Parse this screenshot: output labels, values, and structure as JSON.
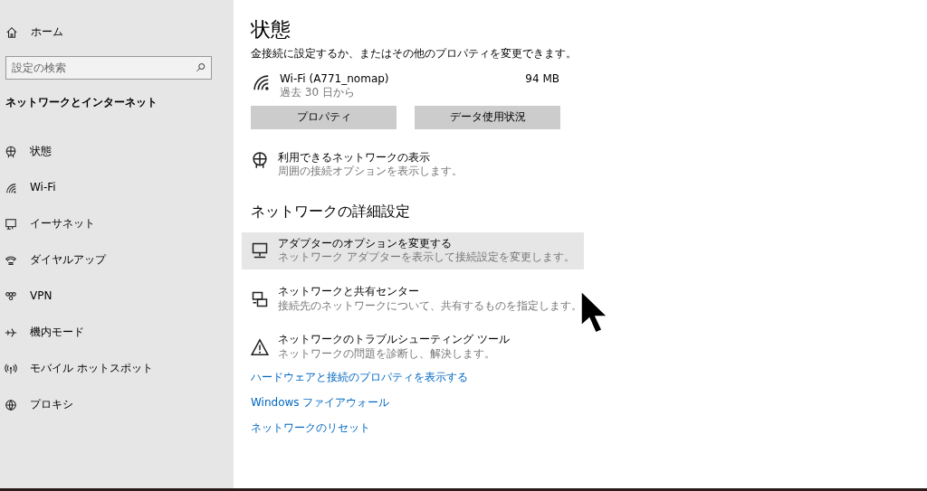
{
  "sidebar": {
    "home": "ホーム",
    "search": {
      "placeholder": "設定の検索"
    },
    "heading": "ネットワークとインターネット",
    "items": [
      {
        "label": "状態",
        "selected": false
      },
      {
        "label": "Wi-Fi",
        "selected": false
      },
      {
        "label": "イーサネット",
        "selected": false
      },
      {
        "label": "ダイヤルアップ",
        "selected": false
      },
      {
        "label": "VPN",
        "selected": false
      },
      {
        "label": "機内モード",
        "selected": false
      },
      {
        "label": "モバイル ホットスポット",
        "selected": false
      },
      {
        "label": "プロキシ",
        "selected": false
      }
    ]
  },
  "main": {
    "title": "状態",
    "intro": "金接続に設定するか、またはその他のプロパティを変更できます。",
    "connection": {
      "name": "Wi-Fi (A771_nomap)",
      "period": "過去 30 日から",
      "usage": "94 MB"
    },
    "buttons": [
      "プロパティ",
      "データ使用状況"
    ],
    "show_networks": {
      "title": "利用できるネットワークの表示",
      "description": "周囲の接続オプションを表示します。"
    },
    "advanced_heading": "ネットワークの詳細設定",
    "advanced_items": [
      {
        "title": "アダプターのオプションを変更する",
        "description": "ネットワーク アダプターを表示して接続設定を変更します。",
        "hovered": true
      },
      {
        "title": "ネットワークと共有センター",
        "description": "接続先のネットワークについて、共有するものを指定します。",
        "hovered": false
      },
      {
        "title": "ネットワークのトラブルシューティング ツール",
        "description": "ネットワークの問題を診断し、解決します。",
        "hovered": false
      }
    ],
    "links": [
      "ハードウェアと接続のプロパティを表示する",
      "Windows ファイアウォール",
      "ネットワークのリセット"
    ]
  }
}
